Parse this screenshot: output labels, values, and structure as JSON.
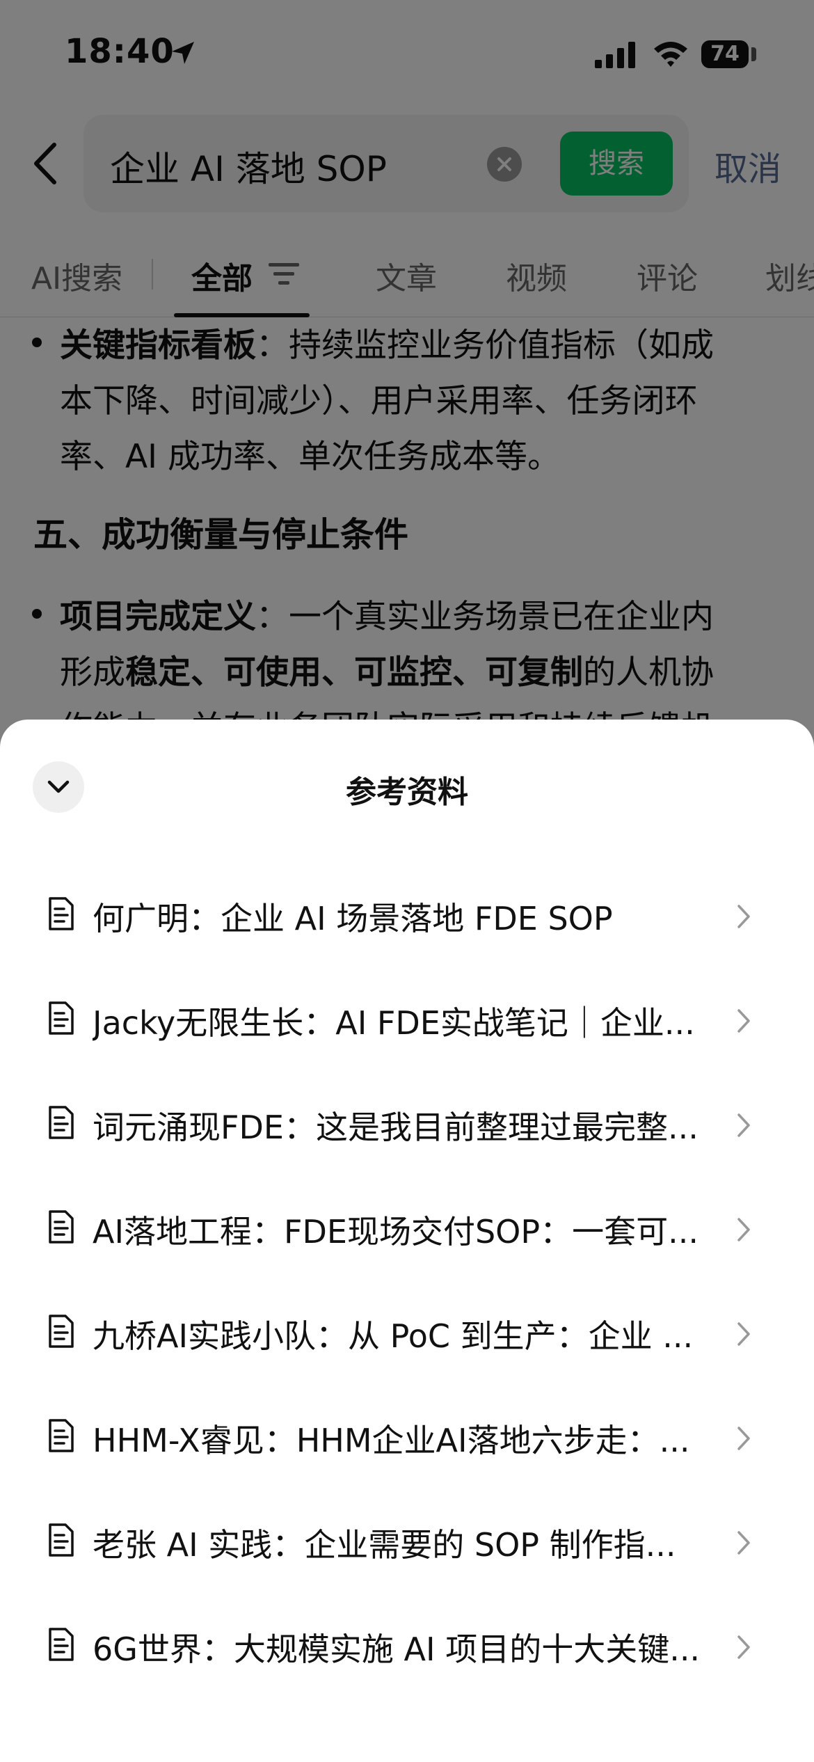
{
  "status_bar": {
    "time": "18:40",
    "battery": "74"
  },
  "search": {
    "query": "企业 AI 落地 SOP",
    "button_label": "搜索",
    "cancel_label": "取消"
  },
  "tabs": [
    {
      "label": "AI搜索"
    },
    {
      "label": "全部"
    },
    {
      "label": "文章"
    },
    {
      "label": "视频"
    },
    {
      "label": "评论"
    },
    {
      "label": "划线"
    }
  ],
  "article": {
    "bullet1": {
      "bold": "关键指标看板",
      "lines": [
        "：持续监控业务价值指标（如成",
        "本下降、时间减少）、用户采用率、任务闭环",
        "率、AI 成功率、单次任务成本等。"
      ]
    },
    "section_heading": "五、成功衡量与停止条件",
    "bullet2": {
      "bold": "项目完成定义",
      "line1": "：一个真实业务场景已在企业内",
      "line2_prefix": "形成",
      "line2_bold": "稳定、可使用、可监控、可复制",
      "line2_suffix": "的人机协",
      "line3": "作能力，并有业务团队实际采用和持续反馈机"
    }
  },
  "sheet": {
    "title": "参考资料",
    "references": [
      "何广明：企业 AI 场景落地 FDE SOP",
      "Jacky无限生长：AI FDE实战笔记｜企业...",
      "词元涌现FDE：这是我目前整理过最完整...",
      "AI落地工程：FDE现场交付SOP：一套可...",
      "九桥AI实践小队：从 PoC 到生产：企业 ...",
      "HHM-X睿见：HHM企业AI落地六步走：...",
      "老张 AI 实践：企业需要的 SOP 制作指...",
      "6G世界：大规模实施 AI 项目的十大关键..."
    ]
  },
  "colors": {
    "accent_green": "#07c160",
    "link_blue": "#576b95",
    "overlay": "rgba(0,0,0,0.5)"
  },
  "icons": [
    "location-arrow-icon",
    "signal-icon",
    "wifi-icon",
    "battery-icon",
    "back-chevron-icon",
    "clear-icon",
    "filter-icon",
    "collapse-chevron-icon",
    "document-icon",
    "chevron-right-icon"
  ]
}
